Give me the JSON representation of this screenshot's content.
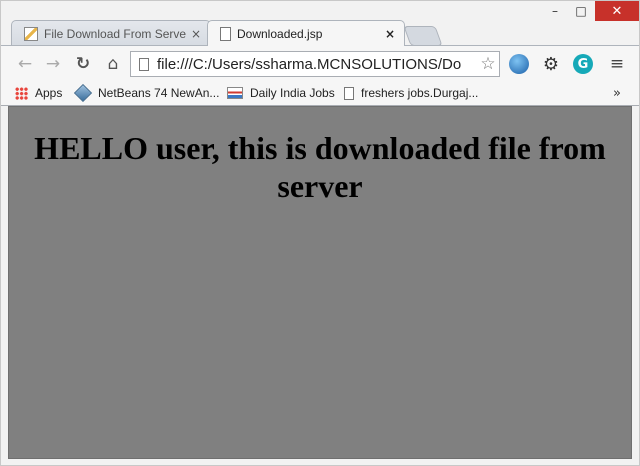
{
  "tabs": [
    {
      "title": "File Download From Serve",
      "close": "×",
      "active": false,
      "icon": "java-icon"
    },
    {
      "title": "Downloaded.jsp",
      "close": "×",
      "active": true,
      "icon": "page-icon"
    }
  ],
  "window_controls": {
    "minimize": "–",
    "maximize": "□",
    "close": "✕"
  },
  "toolbar": {
    "back": "←",
    "forward": "→",
    "reload": "↻",
    "home": "⌂",
    "url": "file:///C:/Users/ssharma.MCNSOLUTIONS/Do",
    "star": "☆",
    "gear": "⚙",
    "grammarly": "G",
    "menu": "≡"
  },
  "bookmarks": [
    {
      "label": "Apps",
      "icon": "apps-grid-icon"
    },
    {
      "label": "NetBeans 74 NewAn...",
      "icon": "netbeans-icon"
    },
    {
      "label": "Daily India Jobs",
      "icon": "daily-india-jobs-icon"
    },
    {
      "label": "freshers jobs.Durgaj...",
      "icon": "page-icon"
    }
  ],
  "bookmarks_more": "»",
  "page": {
    "heading": "HELLO user, this is downloaded file from server",
    "background": "#808080"
  },
  "colors": {
    "close_button": "#c7312a",
    "page_background": "#808080"
  }
}
